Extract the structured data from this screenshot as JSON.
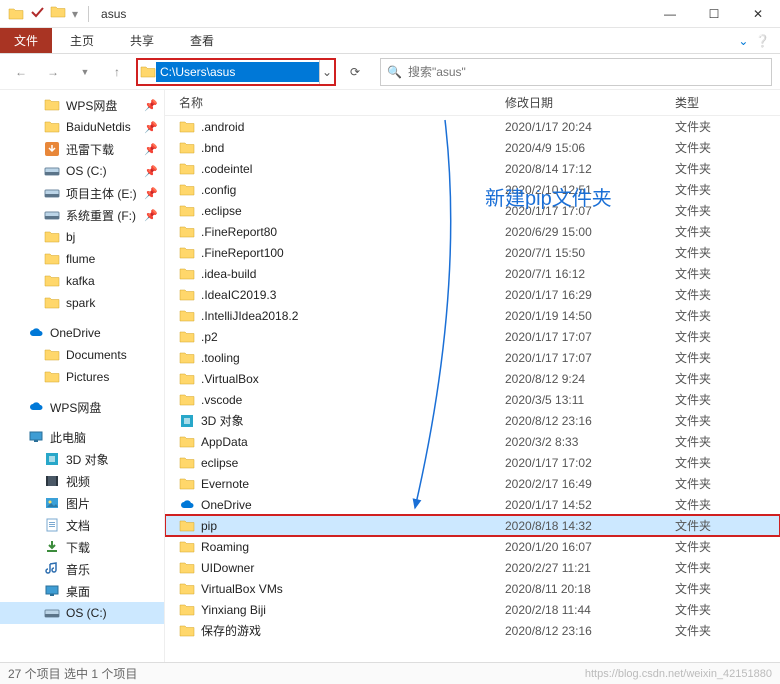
{
  "titlebar": {
    "title": "asus"
  },
  "ribbon": {
    "file": "文件",
    "home": "主页",
    "share": "共享",
    "view": "查看"
  },
  "nav": {
    "path": "C:\\Users\\asus",
    "search_placeholder": "搜索\"asus\""
  },
  "columns": {
    "name": "名称",
    "date": "修改日期",
    "type": "类型"
  },
  "annotation": "新建pip文件夹",
  "sidebar": {
    "quick": [
      {
        "label": "WPS网盘",
        "icon": "folder",
        "pinned": true
      },
      {
        "label": "BaiduNetdis",
        "icon": "folder",
        "pinned": true
      },
      {
        "label": "迅雷下载",
        "icon": "xl",
        "pinned": true
      },
      {
        "label": "OS (C:)",
        "icon": "drive",
        "pinned": true
      },
      {
        "label": "项目主体 (E:)",
        "icon": "drive",
        "pinned": true
      },
      {
        "label": "系统重置 (F:)",
        "icon": "drive",
        "pinned": true
      },
      {
        "label": "bj",
        "icon": "folder",
        "pinned": false
      },
      {
        "label": "flume",
        "icon": "folder",
        "pinned": false
      },
      {
        "label": "kafka",
        "icon": "folder",
        "pinned": false
      },
      {
        "label": "spark",
        "icon": "folder",
        "pinned": false
      }
    ],
    "onedrive": "OneDrive",
    "onedrive_items": [
      {
        "label": "Documents",
        "icon": "folder"
      },
      {
        "label": "Pictures",
        "icon": "folder"
      }
    ],
    "wps": "WPS网盘",
    "thispc": "此电脑",
    "pc_items": [
      {
        "label": "3D 对象",
        "icon": "3d"
      },
      {
        "label": "视频",
        "icon": "video"
      },
      {
        "label": "图片",
        "icon": "pic"
      },
      {
        "label": "文档",
        "icon": "doc"
      },
      {
        "label": "下载",
        "icon": "dl"
      },
      {
        "label": "音乐",
        "icon": "music"
      },
      {
        "label": "桌面",
        "icon": "desk"
      },
      {
        "label": "OS (C:)",
        "icon": "drive",
        "selected": true
      }
    ]
  },
  "files": [
    {
      "name": ".android",
      "date": "2020/1/17 20:24",
      "type": "文件夹",
      "icon": "folder"
    },
    {
      "name": ".bnd",
      "date": "2020/4/9 15:06",
      "type": "文件夹",
      "icon": "folder"
    },
    {
      "name": ".codeintel",
      "date": "2020/8/14 17:12",
      "type": "文件夹",
      "icon": "folder"
    },
    {
      "name": ".config",
      "date": "2020/2/10 12:51",
      "type": "文件夹",
      "icon": "folder"
    },
    {
      "name": ".eclipse",
      "date": "2020/1/17 17:07",
      "type": "文件夹",
      "icon": "folder"
    },
    {
      "name": ".FineReport80",
      "date": "2020/6/29 15:00",
      "type": "文件夹",
      "icon": "folder"
    },
    {
      "name": ".FineReport100",
      "date": "2020/7/1 15:50",
      "type": "文件夹",
      "icon": "folder"
    },
    {
      "name": ".idea-build",
      "date": "2020/7/1 16:12",
      "type": "文件夹",
      "icon": "folder"
    },
    {
      "name": ".IdeaIC2019.3",
      "date": "2020/1/17 16:29",
      "type": "文件夹",
      "icon": "folder"
    },
    {
      "name": ".IntelliJIdea2018.2",
      "date": "2020/1/19 14:50",
      "type": "文件夹",
      "icon": "folder"
    },
    {
      "name": ".p2",
      "date": "2020/1/17 17:07",
      "type": "文件夹",
      "icon": "folder"
    },
    {
      "name": ".tooling",
      "date": "2020/1/17 17:07",
      "type": "文件夹",
      "icon": "folder"
    },
    {
      "name": ".VirtualBox",
      "date": "2020/8/12 9:24",
      "type": "文件夹",
      "icon": "folder"
    },
    {
      "name": ".vscode",
      "date": "2020/3/5 13:11",
      "type": "文件夹",
      "icon": "folder"
    },
    {
      "name": "3D 对象",
      "date": "2020/8/12 23:16",
      "type": "文件夹",
      "icon": "3d"
    },
    {
      "name": "AppData",
      "date": "2020/3/2 8:33",
      "type": "文件夹",
      "icon": "folder"
    },
    {
      "name": "eclipse",
      "date": "2020/1/17 17:02",
      "type": "文件夹",
      "icon": "folder"
    },
    {
      "name": "Evernote",
      "date": "2020/2/17 16:49",
      "type": "文件夹",
      "icon": "folder"
    },
    {
      "name": "OneDrive",
      "date": "2020/1/17 14:52",
      "type": "文件夹",
      "icon": "cloud"
    },
    {
      "name": "pip",
      "date": "2020/8/18 14:32",
      "type": "文件夹",
      "icon": "folder",
      "selected": true,
      "boxed": true
    },
    {
      "name": "Roaming",
      "date": "2020/1/20 16:07",
      "type": "文件夹",
      "icon": "folder"
    },
    {
      "name": "UIDowner",
      "date": "2020/2/27 11:21",
      "type": "文件夹",
      "icon": "folder"
    },
    {
      "name": "VirtualBox VMs",
      "date": "2020/8/11 20:18",
      "type": "文件夹",
      "icon": "folder"
    },
    {
      "name": "Yinxiang Biji",
      "date": "2020/2/18 11:44",
      "type": "文件夹",
      "icon": "folder"
    },
    {
      "name": "保存的游戏",
      "date": "2020/8/12 23:16",
      "type": "文件夹",
      "icon": "folder"
    }
  ],
  "status": {
    "count": "27 个项目    选中 1 个项目",
    "watermark": "https://blog.csdn.net/weixin_42151880"
  }
}
